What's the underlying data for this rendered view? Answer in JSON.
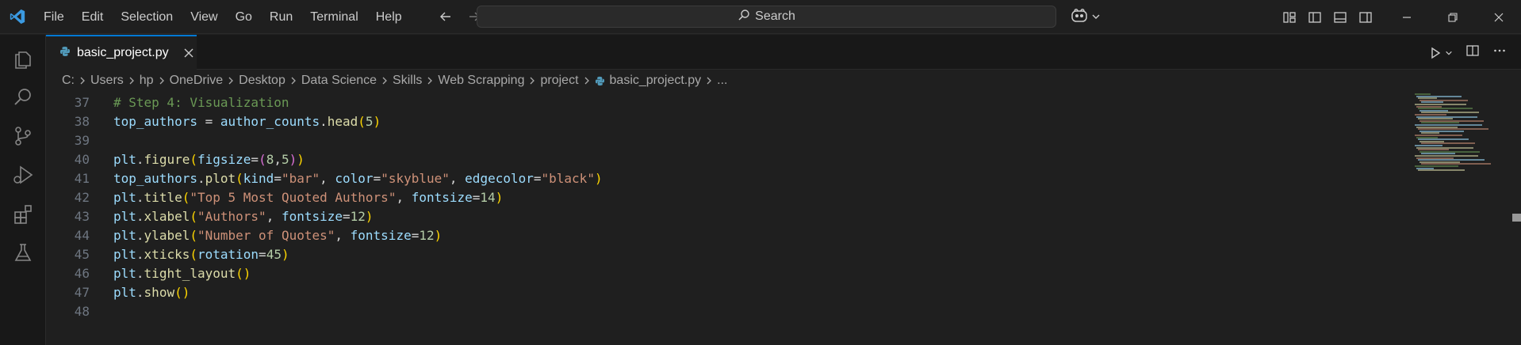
{
  "menu": [
    "File",
    "Edit",
    "Selection",
    "View",
    "Go",
    "Run",
    "Terminal",
    "Help"
  ],
  "search": {
    "label": "Search"
  },
  "tab": {
    "filename": "basic_project.py"
  },
  "breadcrumb": [
    "C:",
    "Users",
    "hp",
    "OneDrive",
    "Desktop",
    "Data Science",
    "Skills",
    "Web Scrapping",
    "project",
    "basic_project.py",
    "..."
  ],
  "editor": {
    "line_numbers": [
      "37",
      "38",
      "39",
      "40",
      "41",
      "42",
      "43",
      "44",
      "45",
      "46",
      "47",
      "48"
    ],
    "lines": [
      [
        {
          "t": "# Step 4: Visualization",
          "c": "cm"
        }
      ],
      [
        {
          "t": "top_authors",
          "c": "var"
        },
        {
          "t": " = ",
          "c": "op"
        },
        {
          "t": "author_counts",
          "c": "var"
        },
        {
          "t": ".",
          "c": "op"
        },
        {
          "t": "head",
          "c": "fn"
        },
        {
          "t": "(",
          "c": "p1"
        },
        {
          "t": "5",
          "c": "num"
        },
        {
          "t": ")",
          "c": "p1"
        }
      ],
      [],
      [
        {
          "t": "plt",
          "c": "var"
        },
        {
          "t": ".",
          "c": "op"
        },
        {
          "t": "figure",
          "c": "fn"
        },
        {
          "t": "(",
          "c": "p1"
        },
        {
          "t": "figsize",
          "c": "var"
        },
        {
          "t": "=",
          "c": "op"
        },
        {
          "t": "(",
          "c": "p2"
        },
        {
          "t": "8",
          "c": "num"
        },
        {
          "t": ",",
          "c": "op"
        },
        {
          "t": "5",
          "c": "num"
        },
        {
          "t": ")",
          "c": "p2"
        },
        {
          "t": ")",
          "c": "p1"
        }
      ],
      [
        {
          "t": "top_authors",
          "c": "var"
        },
        {
          "t": ".",
          "c": "op"
        },
        {
          "t": "plot",
          "c": "fn"
        },
        {
          "t": "(",
          "c": "p1"
        },
        {
          "t": "kind",
          "c": "var"
        },
        {
          "t": "=",
          "c": "op"
        },
        {
          "t": "\"bar\"",
          "c": "str"
        },
        {
          "t": ", ",
          "c": "op"
        },
        {
          "t": "color",
          "c": "var"
        },
        {
          "t": "=",
          "c": "op"
        },
        {
          "t": "\"skyblue\"",
          "c": "str"
        },
        {
          "t": ", ",
          "c": "op"
        },
        {
          "t": "edgecolor",
          "c": "var"
        },
        {
          "t": "=",
          "c": "op"
        },
        {
          "t": "\"black\"",
          "c": "str"
        },
        {
          "t": ")",
          "c": "p1"
        }
      ],
      [
        {
          "t": "plt",
          "c": "var"
        },
        {
          "t": ".",
          "c": "op"
        },
        {
          "t": "title",
          "c": "fn"
        },
        {
          "t": "(",
          "c": "p1"
        },
        {
          "t": "\"Top 5 Most Quoted Authors\"",
          "c": "str"
        },
        {
          "t": ", ",
          "c": "op"
        },
        {
          "t": "fontsize",
          "c": "var"
        },
        {
          "t": "=",
          "c": "op"
        },
        {
          "t": "14",
          "c": "num"
        },
        {
          "t": ")",
          "c": "p1"
        }
      ],
      [
        {
          "t": "plt",
          "c": "var"
        },
        {
          "t": ".",
          "c": "op"
        },
        {
          "t": "xlabel",
          "c": "fn"
        },
        {
          "t": "(",
          "c": "p1"
        },
        {
          "t": "\"Authors\"",
          "c": "str"
        },
        {
          "t": ", ",
          "c": "op"
        },
        {
          "t": "fontsize",
          "c": "var"
        },
        {
          "t": "=",
          "c": "op"
        },
        {
          "t": "12",
          "c": "num"
        },
        {
          "t": ")",
          "c": "p1"
        }
      ],
      [
        {
          "t": "plt",
          "c": "var"
        },
        {
          "t": ".",
          "c": "op"
        },
        {
          "t": "ylabel",
          "c": "fn"
        },
        {
          "t": "(",
          "c": "p1"
        },
        {
          "t": "\"Number of Quotes\"",
          "c": "str"
        },
        {
          "t": ", ",
          "c": "op"
        },
        {
          "t": "fontsize",
          "c": "var"
        },
        {
          "t": "=",
          "c": "op"
        },
        {
          "t": "12",
          "c": "num"
        },
        {
          "t": ")",
          "c": "p1"
        }
      ],
      [
        {
          "t": "plt",
          "c": "var"
        },
        {
          "t": ".",
          "c": "op"
        },
        {
          "t": "xticks",
          "c": "fn"
        },
        {
          "t": "(",
          "c": "p1"
        },
        {
          "t": "rotation",
          "c": "var"
        },
        {
          "t": "=",
          "c": "op"
        },
        {
          "t": "45",
          "c": "num"
        },
        {
          "t": ")",
          "c": "p1"
        }
      ],
      [
        {
          "t": "plt",
          "c": "var"
        },
        {
          "t": ".",
          "c": "op"
        },
        {
          "t": "tight_layout",
          "c": "fn"
        },
        {
          "t": "()",
          "c": "p1"
        }
      ],
      [
        {
          "t": "plt",
          "c": "var"
        },
        {
          "t": ".",
          "c": "op"
        },
        {
          "t": "show",
          "c": "fn"
        },
        {
          "t": "()",
          "c": "p1"
        }
      ],
      []
    ]
  },
  "colors": {
    "accent": "#0078d4",
    "vscode_logo": "#3b9ae1",
    "python_icon": "#519aba"
  },
  "icons": {
    "activity": [
      "explorer-icon",
      "search-icon",
      "source-control-icon",
      "run-debug-icon",
      "extensions-icon",
      "testing-icon"
    ]
  }
}
